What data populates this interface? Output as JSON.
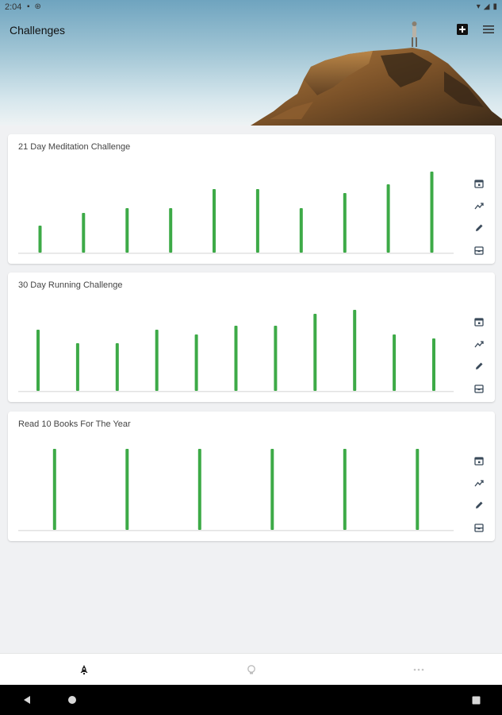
{
  "status_bar": {
    "time": "2:04",
    "left_icons": [
      "sd-card-icon",
      "sync-icon"
    ],
    "right_icons": [
      "wifi-icon",
      "signal-icon",
      "battery-icon"
    ]
  },
  "header": {
    "title": "Challenges",
    "actions": [
      {
        "name": "add-challenge-button",
        "icon": "add-box-icon"
      },
      {
        "name": "menu-button",
        "icon": "menu-icon"
      }
    ]
  },
  "colors": {
    "bar": "#3daa47",
    "baseline": "#e2e2e2",
    "icon": "#3a4a5a",
    "background": "#f0f1f3"
  },
  "cards": [
    {
      "title": "21 Day Meditation Challenge",
      "chart_values": [
        34,
        50,
        56,
        56,
        80,
        80,
        56,
        75,
        86,
        102
      ]
    },
    {
      "title": "30 Day Running Challenge",
      "chart_values": [
        77,
        60,
        60,
        77,
        71,
        82,
        82,
        97,
        102,
        71,
        66
      ]
    },
    {
      "title": "Read 10 Books For The Year",
      "chart_values": [
        102,
        102,
        102,
        102,
        102,
        102
      ]
    }
  ],
  "card_tools": [
    "calendar-icon",
    "trend-icon",
    "edit-icon",
    "archive-icon"
  ],
  "bottom_nav": [
    {
      "name": "nav-challenges",
      "icon": "rocket-icon",
      "active": true
    },
    {
      "name": "nav-ideas",
      "icon": "lightbulb-icon",
      "active": false
    },
    {
      "name": "nav-more",
      "icon": "more-horiz-icon",
      "active": false
    }
  ],
  "system_nav": [
    "back-icon",
    "home-icon",
    "recents-icon"
  ]
}
